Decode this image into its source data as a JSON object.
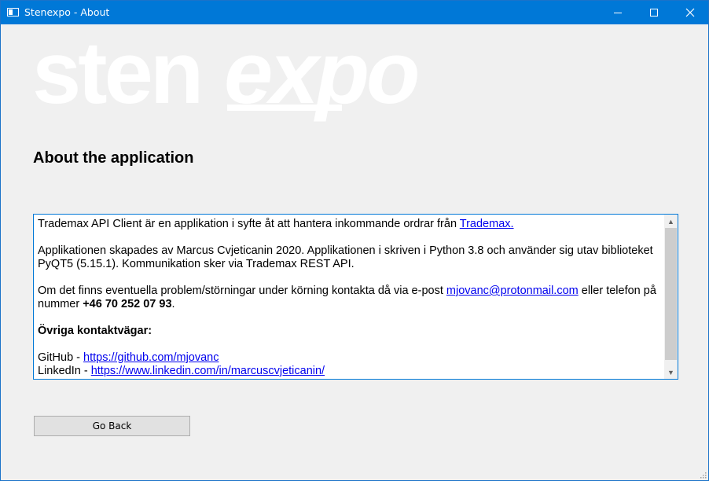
{
  "window": {
    "title": "Stenexpo - About",
    "icon": "app-window-icon",
    "controls": [
      "minimize-icon",
      "maximize-icon",
      "close-icon"
    ]
  },
  "logo": {
    "text_plain": "sten",
    "text_styled": "expo",
    "color": "#ffffff"
  },
  "heading": "About the application",
  "info": {
    "p1_text": "Trademax API Client är en applikation i syfte åt att hantera inkommande ordrar från ",
    "p1_link": "Trademax.",
    "p2_text": "Applikationen skapades av Marcus Cvjeticanin 2020. Applikationen i skriven i Python 3.8 och använder sig utav biblioteket PyQT5 (5.15.1). Kommunikation sker via Trademax REST API.",
    "p3_text_a": "Om det finns eventuella problem/störningar under körning kontakta då via e-post ",
    "p3_email": "mjovanc@protonmail.com",
    "p3_text_b": " eller telefon på nummer ",
    "p3_phone": "+46 70 252 07 93",
    "p3_text_c": ".",
    "contacts_heading": "Övriga kontaktvägar:",
    "github_label": "GitHub - ",
    "github_url": "https://github.com/mjovanc",
    "linkedin_label": "LinkedIn - ",
    "linkedin_url": "https://www.linkedin.com/in/marcuscvjeticanin/"
  },
  "buttons": {
    "go_back": "Go Back"
  },
  "colors": {
    "titlebar": "#0078d7",
    "background": "#f0f0f0",
    "link": "#0000ee"
  }
}
